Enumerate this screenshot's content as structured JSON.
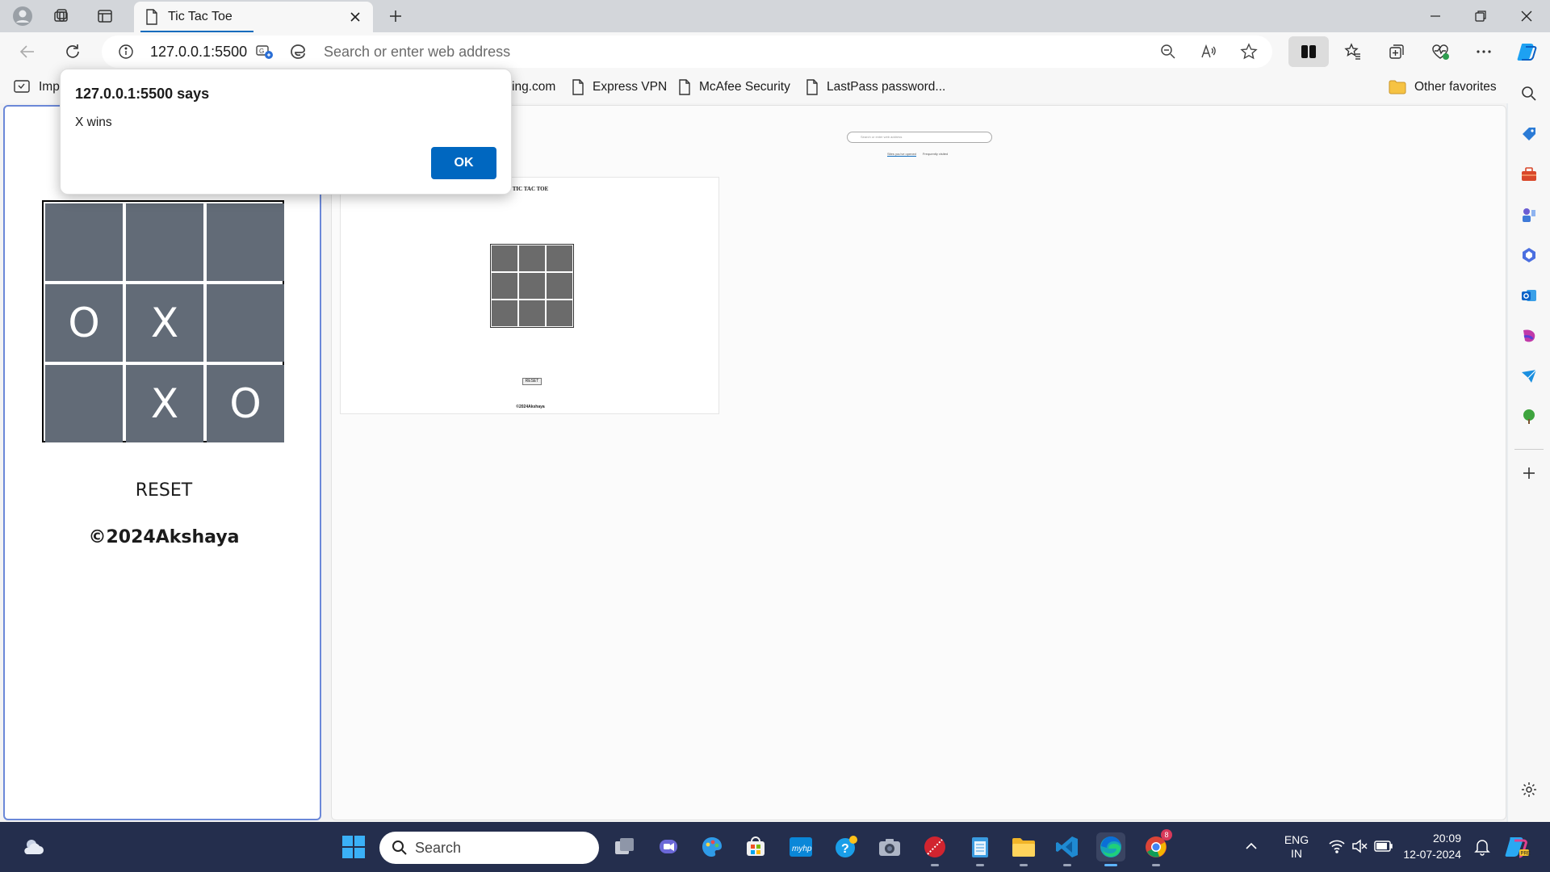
{
  "browser": {
    "tab_title": "Tic Tac Toe",
    "url": "127.0.0.1:5500",
    "address_placeholder": "Search or enter web address"
  },
  "favorites": {
    "items": [
      {
        "label": "Imp"
      },
      {
        "label": "ing.com"
      },
      {
        "label": "Express VPN"
      },
      {
        "label": "McAfee Security"
      },
      {
        "label": "LastPass password..."
      }
    ],
    "other": "Other favorites"
  },
  "alert": {
    "title": "127.0.0.1:5500 says",
    "message": "X wins",
    "ok_label": "OK"
  },
  "game": {
    "cells": [
      "",
      "",
      "",
      "O",
      "X",
      "",
      "",
      "X",
      "O"
    ],
    "reset_label": "RESET",
    "footer": "©2024Akshaya"
  },
  "preview": {
    "title": "TIC TAC TOE",
    "reset_label": "RESET",
    "footer": "©2024Akshaya",
    "search_placeholder": "Search or enter web address",
    "tabs": [
      "Sites you've opened",
      "Frequently visited"
    ]
  },
  "taskbar": {
    "search_label": "Search",
    "lang_line1": "ENG",
    "lang_line2": "IN",
    "time": "20:09",
    "date": "12-07-2024",
    "chrome_badge": "8"
  },
  "colors": {
    "accent": "#0067c0",
    "cell": "#626b77",
    "taskbar": "#242e4d",
    "pane_border": "#6b88d8"
  }
}
